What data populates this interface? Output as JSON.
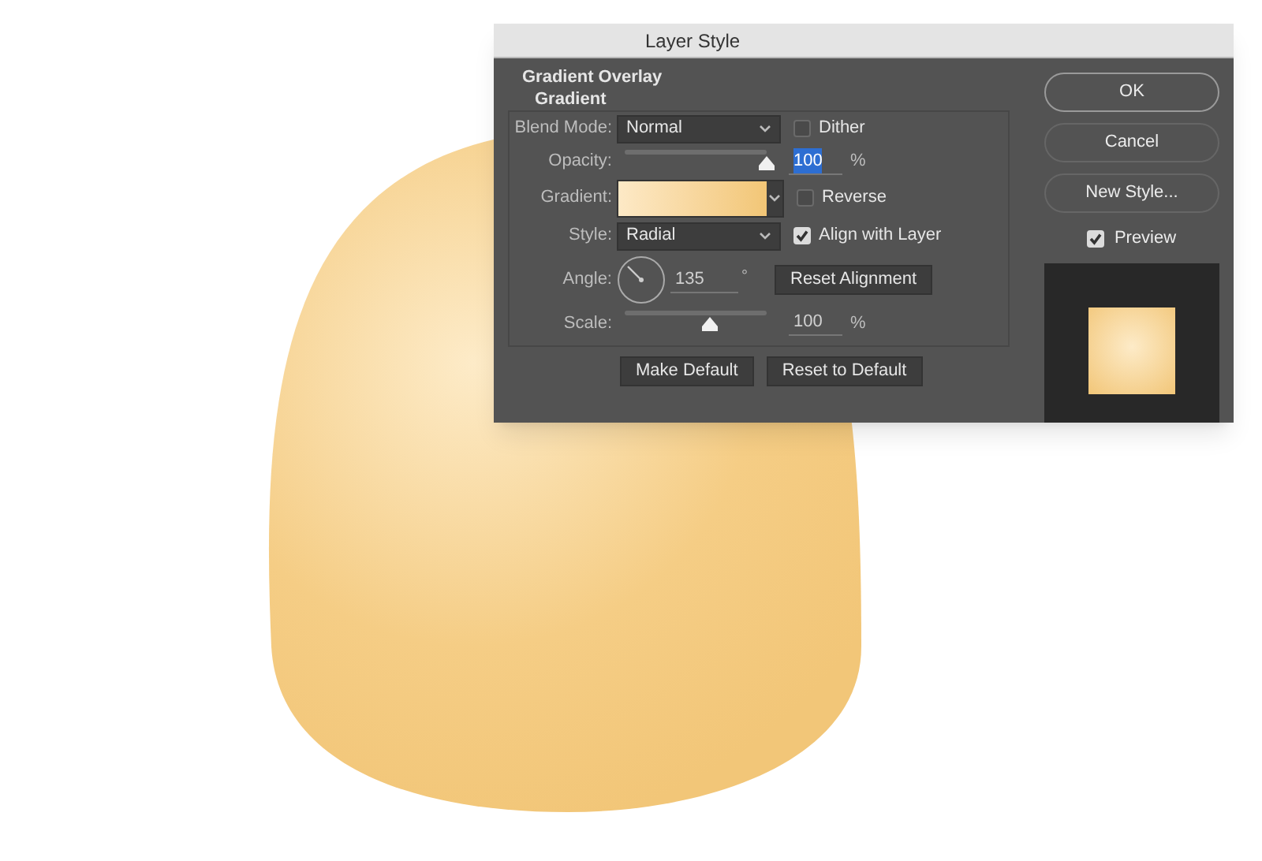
{
  "dialog": {
    "title": "Layer Style",
    "section": "Gradient Overlay",
    "group": "Gradient",
    "blend_mode": {
      "label": "Blend Mode:",
      "value": "Normal"
    },
    "dither": {
      "label": "Dither",
      "checked": false
    },
    "opacity": {
      "label": "Opacity:",
      "value": "100",
      "unit": "%",
      "level": 1,
      "text_selected": true
    },
    "gradient": {
      "label": "Gradient:"
    },
    "reverse": {
      "label": "Reverse",
      "checked": false
    },
    "style": {
      "label": "Style:",
      "value": "Radial"
    },
    "align_with_layer": {
      "label": "Align with Layer",
      "checked": true
    },
    "angle": {
      "label": "Angle:",
      "value": "135",
      "unit": "°"
    },
    "reset_alignment": "Reset Alignment",
    "scale": {
      "label": "Scale:",
      "value": "100",
      "unit": "%",
      "level": 0.6,
      "text_selected": false
    },
    "buttons": [
      "Make Default",
      "Reset to Default"
    ],
    "side_buttons": [
      "OK",
      "Cancel",
      "New Style..."
    ],
    "preview": {
      "label": "Preview",
      "checked": true
    }
  }
}
